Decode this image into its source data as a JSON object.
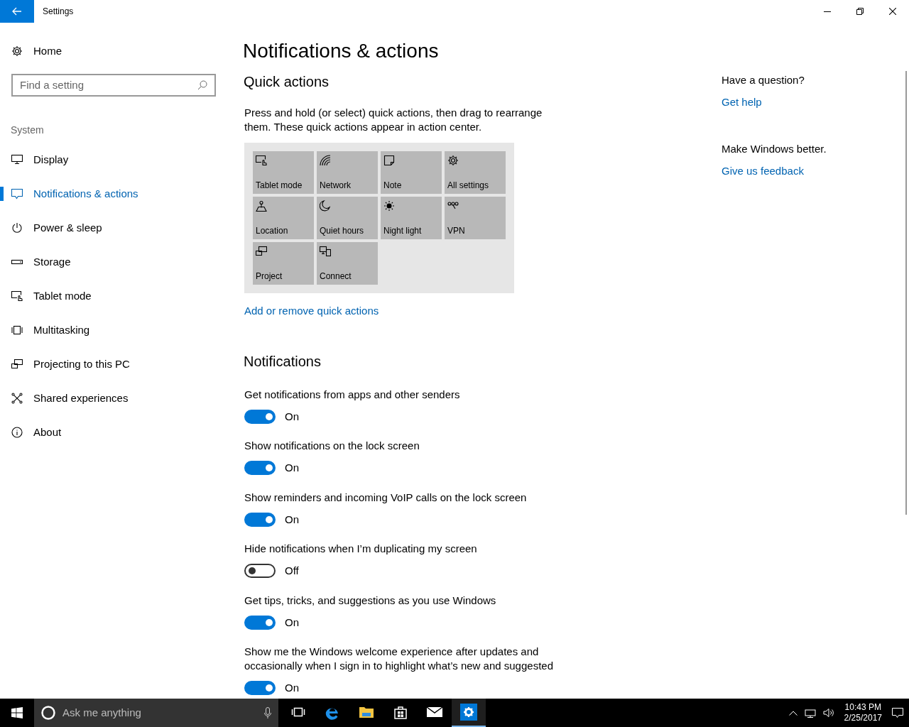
{
  "window": {
    "title": "Settings"
  },
  "sidebar": {
    "home": "Home",
    "search": {
      "placeholder": "Find a setting"
    },
    "section": "System",
    "items": [
      {
        "label": "Display",
        "selected": false
      },
      {
        "label": "Notifications & actions",
        "selected": true
      },
      {
        "label": "Power & sleep",
        "selected": false
      },
      {
        "label": "Storage",
        "selected": false
      },
      {
        "label": "Tablet mode",
        "selected": false
      },
      {
        "label": "Multitasking",
        "selected": false
      },
      {
        "label": "Projecting to this PC",
        "selected": false
      },
      {
        "label": "Shared experiences",
        "selected": false
      },
      {
        "label": "About",
        "selected": false
      }
    ]
  },
  "page": {
    "title": "Notifications & actions",
    "quick_actions": {
      "heading": "Quick actions",
      "description": "Press and hold (or select) quick actions, then drag to rearrange them. These quick actions appear in action center.",
      "tiles": [
        "Tablet mode",
        "Network",
        "Note",
        "All settings",
        "Location",
        "Quiet hours",
        "Night light",
        "VPN",
        "Project",
        "Connect"
      ],
      "link": "Add or remove quick actions"
    },
    "notifications": {
      "heading": "Notifications",
      "settings": [
        {
          "label": "Get notifications from apps and other senders",
          "on": true,
          "state": "On"
        },
        {
          "label": "Show notifications on the lock screen",
          "on": true,
          "state": "On"
        },
        {
          "label": "Show reminders and incoming VoIP calls on the lock screen",
          "on": true,
          "state": "On"
        },
        {
          "label": "Hide notifications when I’m duplicating my screen",
          "on": false,
          "state": "Off"
        },
        {
          "label": "Get tips, tricks, and suggestions as you use Windows",
          "on": true,
          "state": "On"
        },
        {
          "label": "Show me the Windows welcome experience after updates and occasionally when I sign in to highlight what’s new and suggested",
          "on": true,
          "state": "On"
        }
      ]
    }
  },
  "help": [
    {
      "question": "Have a question?",
      "link": "Get help"
    },
    {
      "question": "Make Windows better.",
      "link": "Give us feedback"
    }
  ],
  "taskbar": {
    "search": {
      "placeholder": "Ask me anything"
    },
    "apps": [
      {
        "selected": false
      },
      {
        "selected": false
      },
      {
        "selected": false
      },
      {
        "selected": false
      },
      {
        "selected": false
      },
      {
        "selected": true
      }
    ],
    "time": "10:43 PM",
    "date": "2/25/2017"
  }
}
